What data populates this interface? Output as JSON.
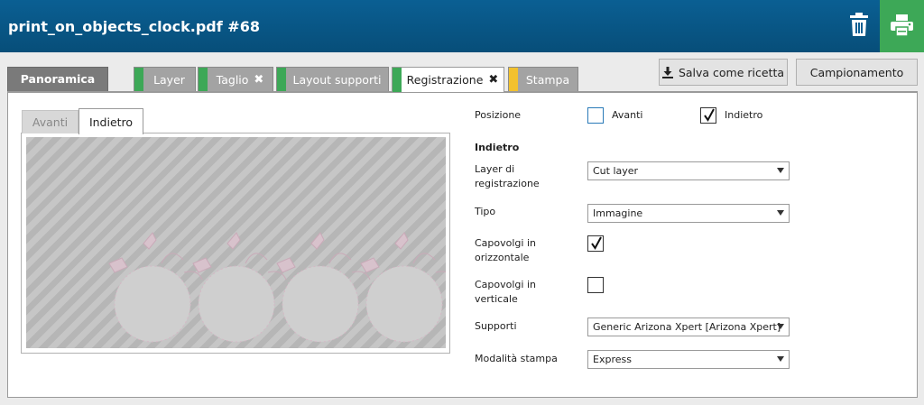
{
  "header": {
    "title": "print_on_objects_clock.pdf #68",
    "trash_icon": "trash-icon",
    "print_icon": "printer-icon",
    "print_button_color": "#3da857"
  },
  "tabs": [
    {
      "label": "Panoramica",
      "stripe": null,
      "active": false
    },
    {
      "label": "Layer",
      "stripe": "#3da857",
      "active": false
    },
    {
      "label": "Taglio",
      "stripe": "#3da857",
      "active": false,
      "close": "✖"
    },
    {
      "label": "Layout supporti",
      "stripe": "#3da857",
      "active": false
    },
    {
      "label": "Registrazione",
      "stripe": "#3da857",
      "active": true,
      "close": "✖"
    },
    {
      "label": "Stampa",
      "stripe": "#f2c12e",
      "active": false
    }
  ],
  "actions": {
    "save_recipe": "Salva come ricetta",
    "sampling": "Campionamento"
  },
  "preview_tabs": {
    "front": "Avanti",
    "back": "Indietro"
  },
  "form": {
    "position_label": "Posizione",
    "position_front": {
      "label": "Avanti",
      "checked": false
    },
    "position_back": {
      "label": "Indietro",
      "checked": true
    },
    "section_title": "Indietro",
    "registration_layer_label": "Layer di registrazione",
    "registration_layer_value": "Cut layer",
    "type_label": "Tipo",
    "type_value": "Immagine",
    "flip_horizontal_label": "Capovolgi in orizzontale",
    "flip_horizontal_checked": true,
    "flip_vertical_label": "Capovolgi in verticale",
    "flip_vertical_checked": false,
    "media_label": "Supporti",
    "media_value": "Generic Arizona Xpert [Arizona Xpert]",
    "print_mode_label": "Modalità stampa",
    "print_mode_value": "Express"
  }
}
